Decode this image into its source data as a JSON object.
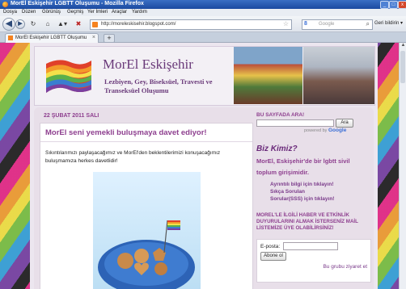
{
  "window": {
    "title": "MorEl Eskişehir LGBTT Oluşumu - Mozilla Firefox",
    "controls": [
      "_",
      "□",
      "x"
    ]
  },
  "menu": [
    "Dosya",
    "Düzen",
    "Görünüş",
    "Geçmiş",
    "Yer İmleri",
    "Araçlar",
    "Yardım"
  ],
  "nav": {
    "url": "http://moreleskisehir.blogspot.com/",
    "search_placeholder": "Google",
    "back_label": "Geri bildirin ▾"
  },
  "tabs": [
    {
      "label": "MorEl Eskişehir LGBTT Oluşumu"
    }
  ],
  "header": {
    "title": "MorEl Eskişehir",
    "description": "Lezbiyen, Gey, Biseksüel, Travesti ve Transeksüel Oluşumu"
  },
  "post": {
    "date": "22 ŞUBAT 2011 SALI",
    "title": "MorEl seni yemekli buluşmaya davet ediyor!",
    "body": "Sıkıntılarımızı paylaşacağımız ve MorEl'den beklentilerimizi konuşacağımız buluşmamıza herkes davetlidir!"
  },
  "sidebar": {
    "search_title": "BU SAYFADA ARA!",
    "search_button": "Ara",
    "powered_by": "powered by",
    "powered_brand": "Google",
    "about_title": "Biz Kimiz?",
    "about_text": "MorEl, Eskişehir'de bir lgbtt sivil toplum girişimidir.",
    "links": [
      "Ayrıntılı bilgi için tıklayın!",
      "Sıkça Sorulan",
      "Sorular(SSS) için tıklayın!"
    ],
    "mailing_text": "MOREL'LE İLGİLİ HABER VE ETKİNLİK DUYURULARINI ALMAK İSTERSENİZ MAİL LİSTEMİZE ÜYE OLABİLİRSİNİZ!",
    "email_label": "E-posta:",
    "subscribe_button": "Abone ol",
    "group_link": "Bu grubu ziyaret et"
  }
}
